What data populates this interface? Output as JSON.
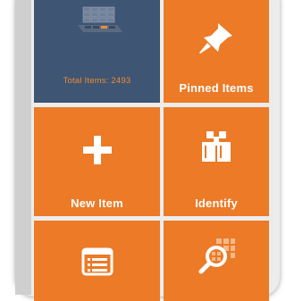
{
  "dashboard": {
    "tiles": [
      {
        "label": "Total Items: 2493",
        "icon": "database-grid-icon",
        "color": "#3e5574"
      },
      {
        "label": "Pinned Items",
        "icon": "pushpin-icon",
        "color": "#ec7a26"
      },
      {
        "label": "New Item",
        "icon": "plus-icon",
        "color": "#ec7a26"
      },
      {
        "label": "Identify",
        "icon": "binoculars-icon",
        "color": "#ec7a26"
      },
      {
        "label": "",
        "icon": "list-icon",
        "color": "#ec7a26"
      },
      {
        "label": "",
        "icon": "grid-search-icon",
        "color": "#ec7a26"
      }
    ]
  }
}
